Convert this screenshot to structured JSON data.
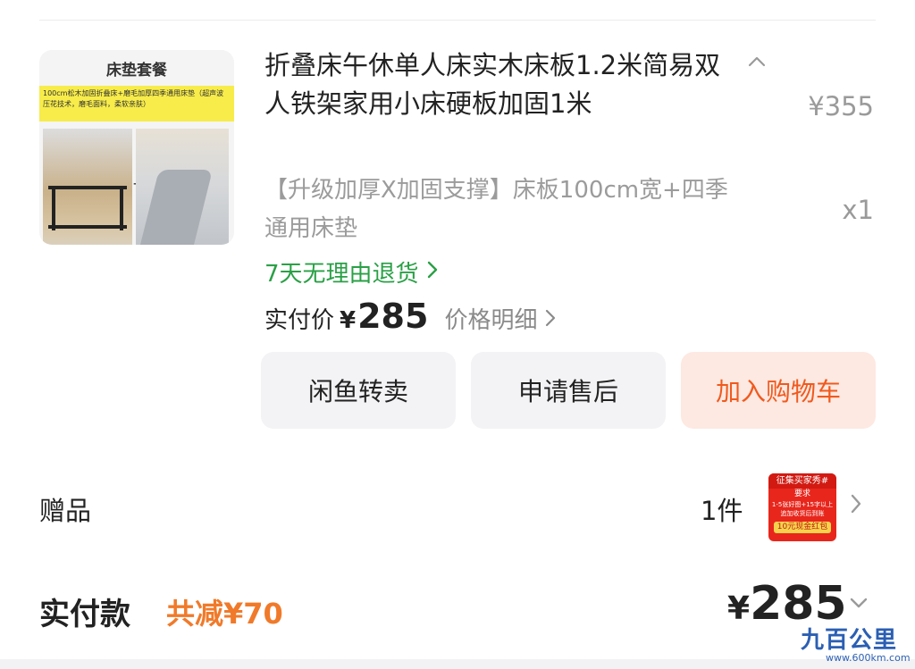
{
  "product": {
    "thumbnail": {
      "title": "床垫套餐",
      "banner": "100cm松木加固折叠床+磨毛加厚四季通用床垫（超声波压花技术，磨毛面料，柔软亲肤）",
      "plus": "+"
    },
    "title": "折叠床午休单人床实木床板1.2米简易双人铁架家用小床硬板加固1米",
    "original_price": "¥355",
    "spec": "【升级加厚X加固支撑】床板100cm宽+四季通用床垫",
    "quantity": "x1",
    "return_policy": "7天无理由退货",
    "paid_label": "实付价",
    "paid_currency": "¥",
    "paid_amount": "285",
    "price_detail": "价格明细"
  },
  "actions": {
    "resell": "闲鱼转卖",
    "after_sale": "申请售后",
    "add_to_cart": "加入购物车"
  },
  "gift": {
    "label": "赠品",
    "count": "1件",
    "image_text": {
      "top": "征集买家秀#",
      "line1": "要求",
      "line2": "1-5张好图+15字以上",
      "line3": "追加收货后到账",
      "coupon": "10元现金红包"
    }
  },
  "summary": {
    "label": "实付款",
    "discount": "共减¥70",
    "currency": "¥",
    "total": "285"
  },
  "watermark": {
    "logo": "九百公里",
    "url": "www.600km.com"
  },
  "colors": {
    "green": "#2aa046",
    "cart_text": "#f05a1e",
    "cart_bg": "#fde9e2",
    "discount": "#f07a2a",
    "muted": "#9a9a9a"
  },
  "icons": {
    "collapse": "chevron-up-icon",
    "return_arrow": "chevron-right-icon",
    "detail_arrow": "chevron-right-icon",
    "gift_arrow": "chevron-right-icon",
    "total_toggle": "chevron-down-icon"
  }
}
